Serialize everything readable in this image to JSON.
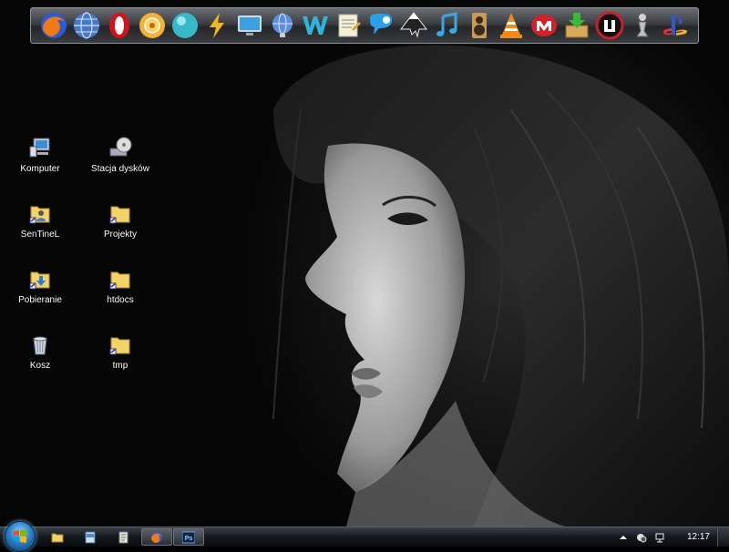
{
  "dock": {
    "items": [
      {
        "name": "firefox-icon"
      },
      {
        "name": "globe-icon"
      },
      {
        "name": "opera-icon"
      },
      {
        "name": "media-disc-icon"
      },
      {
        "name": "teal-sphere-icon"
      },
      {
        "name": "lightning-icon"
      },
      {
        "name": "monitor-icon"
      },
      {
        "name": "network-globe-icon"
      },
      {
        "name": "word-w-icon"
      },
      {
        "name": "notepad-icon"
      },
      {
        "name": "chat-bubble-icon"
      },
      {
        "name": "inkscape-icon"
      },
      {
        "name": "music-note-icon"
      },
      {
        "name": "speaker-icon"
      },
      {
        "name": "vlc-cone-icon"
      },
      {
        "name": "m-badge-icon"
      },
      {
        "name": "download-box-icon"
      },
      {
        "name": "unreal-icon"
      },
      {
        "name": "chess-pawn-icon"
      },
      {
        "name": "playstation-icon"
      }
    ]
  },
  "desktop": {
    "icons": [
      {
        "label": "Komputer",
        "icon": "computer-icon"
      },
      {
        "label": "Stacja dysków",
        "icon": "dvd-drive-icon"
      },
      {
        "label": "SenTineL",
        "icon": "user-folder-icon"
      },
      {
        "label": "Projekty",
        "icon": "folder-shortcut-icon"
      },
      {
        "label": "Pobieranie",
        "icon": "downloads-folder-icon"
      },
      {
        "label": "htdocs",
        "icon": "folder-shortcut-icon"
      },
      {
        "label": "Kosz",
        "icon": "recycle-bin-icon"
      },
      {
        "label": "tmp",
        "icon": "folder-shortcut-icon"
      }
    ]
  },
  "taskbar": {
    "buttons": [
      {
        "name": "explorer-icon"
      },
      {
        "name": "window-icon"
      },
      {
        "name": "notes-icon"
      },
      {
        "name": "firefox-icon",
        "active": true
      },
      {
        "name": "photoshop-icon",
        "text": "Ps"
      }
    ],
    "tray": {
      "clock": "12:17"
    }
  },
  "colors": {
    "dock_bg": "#3b3d41",
    "start_orb": "#2d7fc9",
    "taskbar_bg": "#15181c"
  }
}
